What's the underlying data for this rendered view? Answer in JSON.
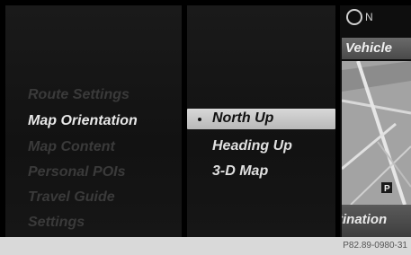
{
  "main_menu": {
    "items": [
      {
        "label": "Route Settings",
        "active": false
      },
      {
        "label": "Map Orientation",
        "active": true
      },
      {
        "label": "Map Content",
        "active": false
      },
      {
        "label": "Personal POIs",
        "active": false
      },
      {
        "label": "Travel Guide",
        "active": false
      },
      {
        "label": "Settings",
        "active": false
      }
    ]
  },
  "orientation_menu": {
    "selected": "North Up",
    "items": [
      "North Up",
      "Heading Up",
      "3-D Map"
    ]
  },
  "map_panel": {
    "compass_label": "N",
    "vehicle_label": "Vehicle",
    "destination_label": "tination",
    "map_marker": "P"
  },
  "footer": {
    "image_code": "P82.89-0980-31"
  },
  "colors": {
    "menu_active": "#e8e8e8",
    "menu_inactive": "#3a3a3a",
    "selection_bg": "#c8c8c8"
  }
}
